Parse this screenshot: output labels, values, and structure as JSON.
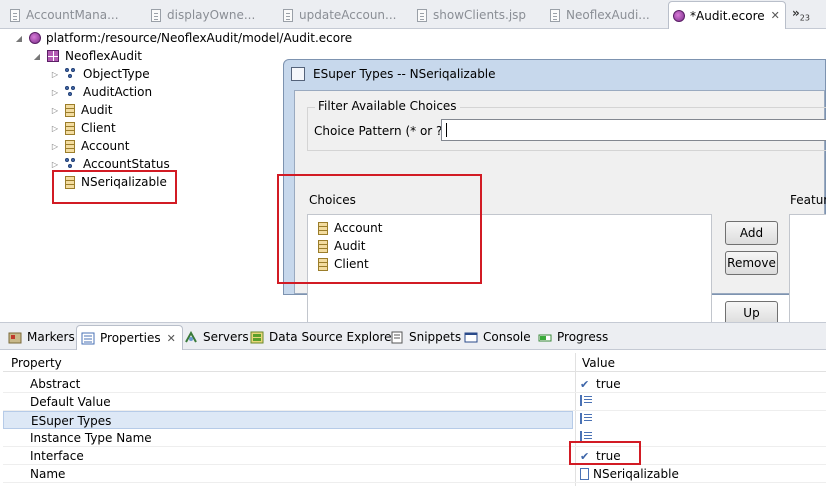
{
  "editor_tabs": [
    {
      "label": "AccountMana...",
      "icon": "file-icon",
      "active": false
    },
    {
      "label": "displayOwne...",
      "icon": "file-icon",
      "active": false
    },
    {
      "label": "updateAccoun...",
      "icon": "file-icon",
      "active": false
    },
    {
      "label": "showClients.jsp",
      "icon": "file-icon",
      "active": false
    },
    {
      "label": "NeoflexAudi...",
      "icon": "file-icon",
      "active": false
    },
    {
      "label": "*Audit.ecore",
      "icon": "ecore-icon",
      "active": true,
      "close": "✕"
    }
  ],
  "editor_overflow": {
    "symbol": "»",
    "count": "23"
  },
  "tree": {
    "resource": "platform:/resource/NeoflexAudit/model/Audit.ecore",
    "package": "NeoflexAudit",
    "items": [
      {
        "label": "ObjectType",
        "icon": "eenum-icon"
      },
      {
        "label": "AuditAction",
        "icon": "eenum-icon"
      },
      {
        "label": "Audit",
        "icon": "eclass-icon"
      },
      {
        "label": "Client",
        "icon": "eclass-icon"
      },
      {
        "label": "Account",
        "icon": "eclass-icon"
      },
      {
        "label": "AccountStatus",
        "icon": "eenum-icon"
      },
      {
        "label": "NSeriqalizable",
        "icon": "eclass-icon"
      }
    ]
  },
  "dialog": {
    "title": "ESuper Types -- NSeriqalizable",
    "filter_group": "Filter Available Choices",
    "choice_pattern_label": "Choice Pattern (* or ?)",
    "choice_pattern_value": "",
    "choices_label": "Choices",
    "choices": [
      "Account",
      "Audit",
      "Client"
    ],
    "feature_label": "Feature",
    "buttons": {
      "add": "Add",
      "remove": "Remove",
      "up": "Up"
    }
  },
  "view_tabs": [
    {
      "label": "Markers",
      "icon": "markers-icon"
    },
    {
      "label": "Properties",
      "icon": "properties-icon",
      "active": true,
      "close": "✕"
    },
    {
      "label": "Servers",
      "icon": "servers-icon"
    },
    {
      "label": "Data Source Explorer",
      "icon": "datasource-icon"
    },
    {
      "label": "Snippets",
      "icon": "snippets-icon"
    },
    {
      "label": "Console",
      "icon": "console-icon"
    },
    {
      "label": "Progress",
      "icon": "progress-icon"
    }
  ],
  "properties": {
    "headers": {
      "property": "Property",
      "value": "Value"
    },
    "rows": [
      {
        "name": "Abstract",
        "value": "true",
        "icon": "check"
      },
      {
        "name": "Default Value",
        "value": "",
        "icon": "list"
      },
      {
        "name": "ESuper Types",
        "value": "",
        "icon": "list",
        "selected": true
      },
      {
        "name": "Instance Type Name",
        "value": "",
        "icon": "list"
      },
      {
        "name": "Interface",
        "value": "true",
        "icon": "check"
      },
      {
        "name": "Name",
        "value": "NSeriqalizable",
        "icon": "list"
      }
    ]
  },
  "colors": {
    "highlight_box": "#d21b24",
    "selection": "#dde8f6",
    "dialog_frame": "#c7d8ec"
  }
}
